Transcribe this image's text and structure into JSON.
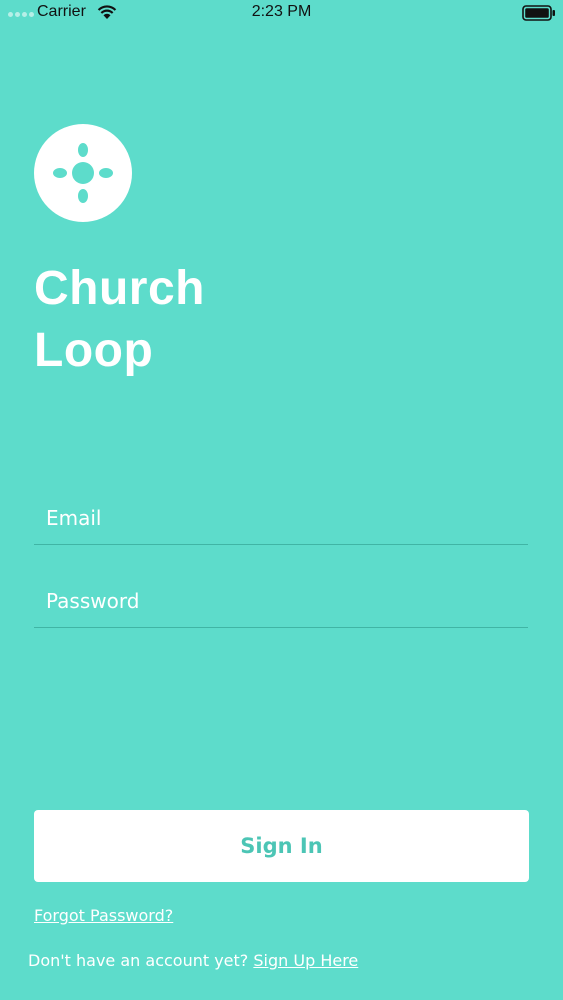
{
  "status_bar": {
    "carrier": "Carrier",
    "time": "2:23 PM",
    "wifi_icon": "wifi-icon",
    "battery_icon": "battery-icon"
  },
  "branding": {
    "logo_icon": "church-loop-logo-icon",
    "app_name_line1": "Church",
    "app_name_line2": "Loop",
    "background_color": "#5ddccb",
    "accent_color": "#4cc5b5"
  },
  "form": {
    "email": {
      "value": "",
      "placeholder": "Email"
    },
    "password": {
      "value": "",
      "placeholder": "Password"
    },
    "sign_in_label": "Sign In"
  },
  "links": {
    "forgot_password": "Forgot Password?",
    "no_account_prompt": "Don't have an account yet?",
    "sign_up": "Sign Up Here"
  }
}
